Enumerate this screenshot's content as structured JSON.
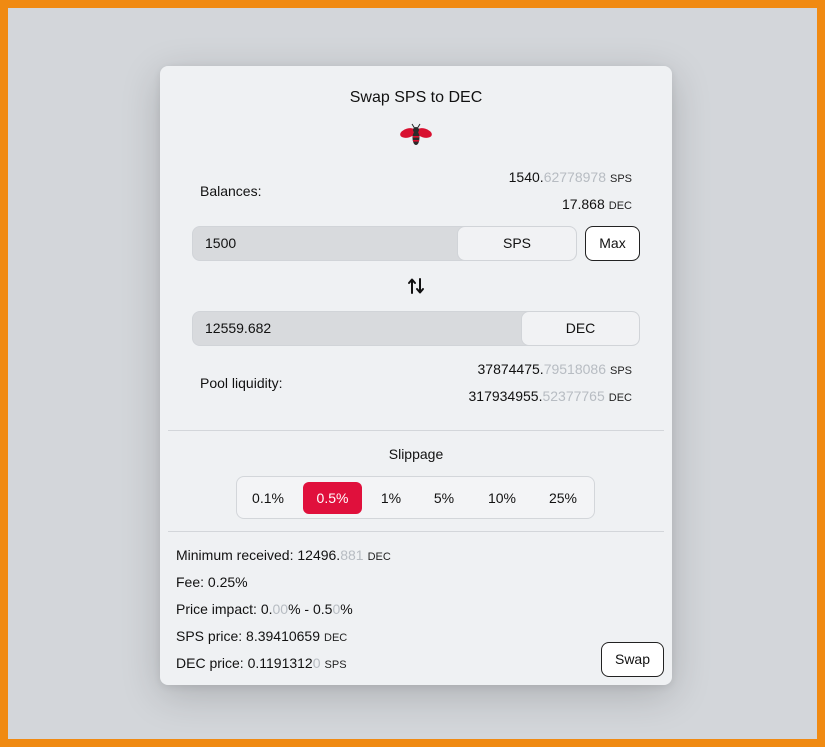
{
  "modal": {
    "title": "Swap SPS to DEC"
  },
  "balances": {
    "label": "Balances:",
    "sps": {
      "whole": "1540.",
      "fraction": "62778978",
      "unit": "SPS"
    },
    "dec": {
      "whole": "17.868",
      "unit": "DEC"
    }
  },
  "input": {
    "value": "1500",
    "token": "SPS",
    "max_label": "Max"
  },
  "output": {
    "value": "12559.682",
    "token": "DEC"
  },
  "pool": {
    "label": "Pool liquidity:",
    "sps": {
      "whole": "37874475.",
      "fraction": "79518086",
      "unit": "SPS"
    },
    "dec": {
      "whole": "317934955.",
      "fraction": "52377765",
      "unit": "DEC"
    }
  },
  "slippage": {
    "title": "Slippage",
    "options": [
      "0.1%",
      "0.5%",
      "1%",
      "5%",
      "10%",
      "25%"
    ],
    "selected": "0.5%"
  },
  "details": {
    "min_received": {
      "label": "Minimum received: ",
      "whole": "12496.",
      "fraction": "881",
      "unit": "DEC"
    },
    "fee": {
      "label": "Fee: 0.25%"
    },
    "price_impact": {
      "label": "Price impact: ",
      "a_main": "0.",
      "a_dim": "00",
      "a_pct": "%",
      "sep": " - ",
      "b_main": "0.5",
      "b_dim": "0",
      "b_pct": "%"
    },
    "sps_price": {
      "label": "SPS price: ",
      "value": "8.39410659",
      "unit": "DEC"
    },
    "dec_price": {
      "label": "DEC price: ",
      "value": "0.1191312",
      "dim": "0",
      "unit": "SPS"
    }
  },
  "swap_button": "Swap",
  "colors": {
    "accent": "#e0103c",
    "frame": "#f08a12",
    "dim_digits": "#b7bcc2"
  },
  "icons": {
    "logo": "wasp-logo-icon",
    "swap_direction": "swap-vertical-arrows-icon"
  }
}
